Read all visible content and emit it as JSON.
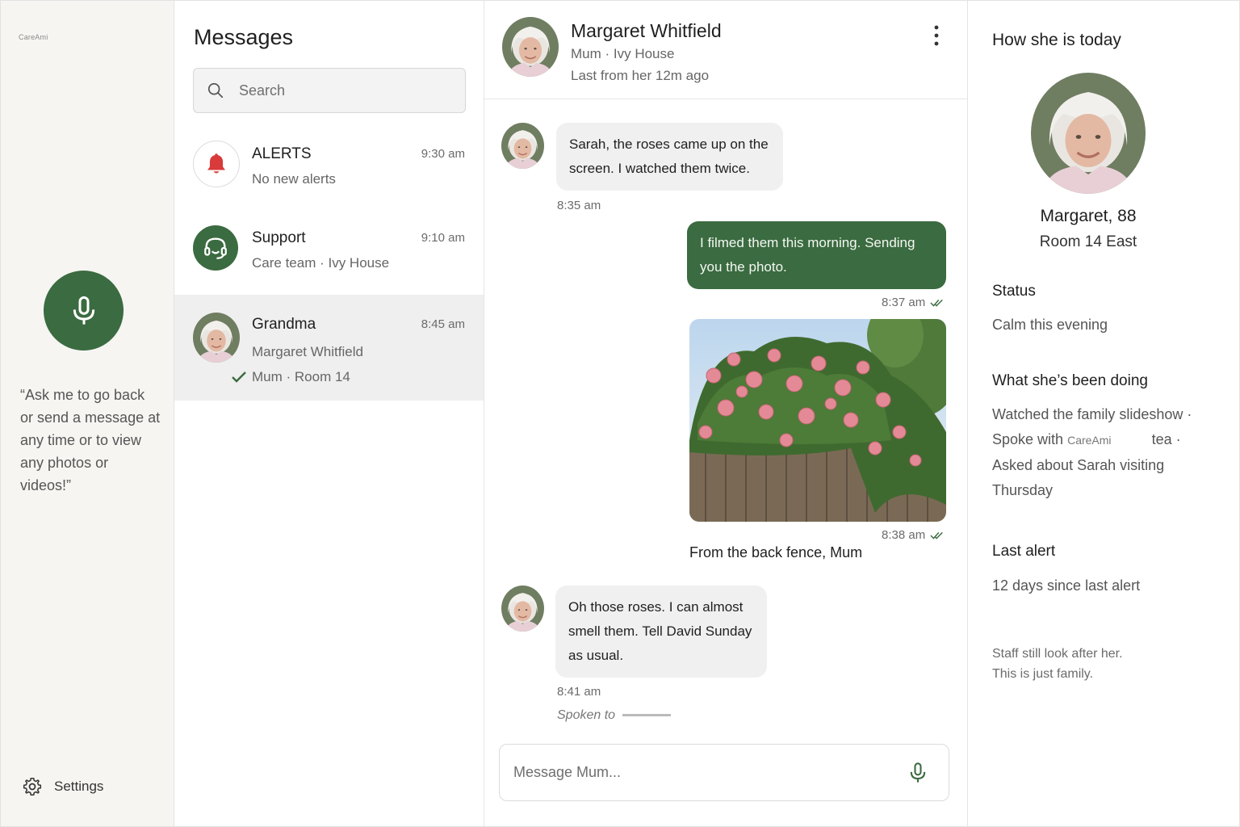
{
  "brand": "CareAmi",
  "rail": {
    "hint": "“Ask me to go back or send a message at any time or to view any photos or videos!”",
    "settings_label": "Settings"
  },
  "list": {
    "title": "Messages",
    "search_placeholder": "Search",
    "conversations": [
      {
        "name": "ALERTS",
        "time": "9:30 am",
        "sub": "No new alerts"
      },
      {
        "name": "Support",
        "time": "9:10 am",
        "sub": "Care team · Ivy House"
      },
      {
        "name": "Grandma",
        "time": "8:45 am",
        "sub": "Margaret Whitfield",
        "sub2": "Mum · Room 14"
      }
    ]
  },
  "chat": {
    "name": "Margaret Whitfield",
    "sub": "Mum · Ivy House",
    "last_seen": "Last from her 12m ago",
    "messages": [
      {
        "text": "Sarah, the roses came up on the screen. I watched them twice.",
        "time": "8:35 am"
      },
      {
        "text": "I filmed them this morning. Sending you the photo.",
        "time": "8:37 am"
      },
      {
        "time": "8:38 am",
        "caption": "From the back fence, Mum"
      },
      {
        "text": "Oh those roses. I can almost smell them. Tell David Sunday as usual.",
        "time": "8:41 am",
        "note": "Spoken to"
      }
    ],
    "composer_placeholder": "Message Mum..."
  },
  "profile": {
    "title": "How she is today",
    "name": "Margaret, 88",
    "room": "Room 14 East",
    "status_heading": "Status",
    "status_text": "Calm this evening",
    "doing_heading": "What she’s been doing",
    "doing_1": "Watched the family slideshow ·",
    "doing_2a": "Spoke with",
    "doing_2b": "tea ·",
    "doing_3": "Asked about Sarah visiting",
    "doing_4": "Thursday",
    "alert_heading": "Last alert",
    "alert_text": "12 days since last alert",
    "note_1": "Staff still look after her.",
    "note_2": "This is just family."
  },
  "colors": {
    "accent": "#3b6b40",
    "alert": "#d93a3a"
  },
  "icons": [
    "microphone-icon",
    "gear-icon",
    "search-icon",
    "bell-icon",
    "headset-icon",
    "kebab-icon",
    "double-check-icon",
    "check-icon"
  ]
}
